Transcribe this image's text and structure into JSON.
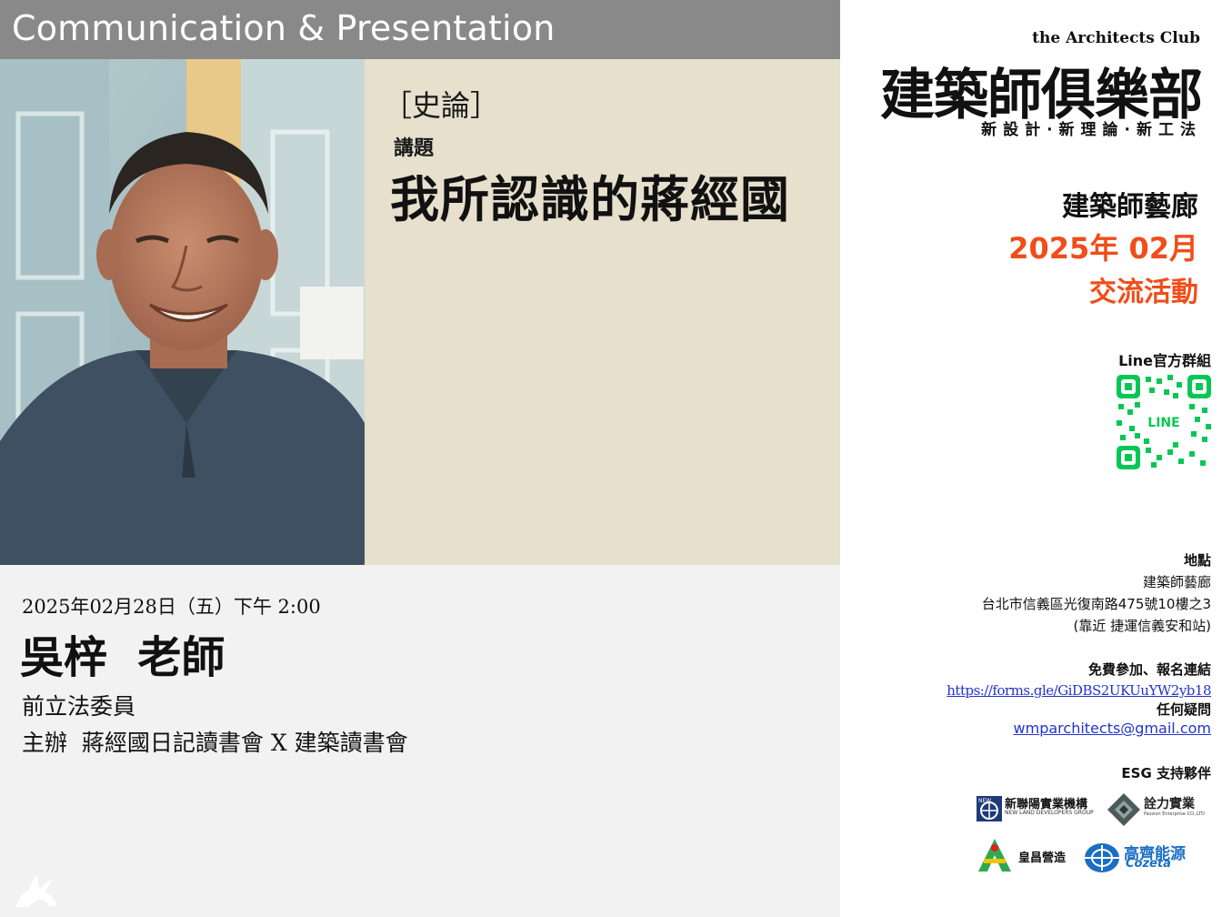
{
  "header": {
    "title": "Communication & Presentation"
  },
  "topic": {
    "category": "［史論］",
    "label": "講題",
    "title": "我所認識的蔣經國"
  },
  "event": {
    "datetime": "2025年02月28日（五）下午  2:00",
    "speaker": "吳梓  老師",
    "role": "前立法委員",
    "host": "主辦  蔣經國日記讀書會 X 建築讀書會"
  },
  "club": {
    "name_en": "the Architects Club",
    "name_zh": "建築師俱樂部",
    "slogan": "新設計·新理論·新工法",
    "gallery": "建築師藝廊",
    "month": "2025年 02月",
    "event_type": "交流活動"
  },
  "line": {
    "label": "Line官方群組",
    "qr_text": "LINE"
  },
  "location": {
    "label": "地點",
    "venue": "建築師藝廊",
    "address": "台北市信義區光復南路475號10樓之3",
    "near": "(靠近 捷運信義安和站)"
  },
  "registration": {
    "label": "免費參加、報名連結",
    "url": "https://forms.gle/GiDBS2UKUuYW2yb18",
    "question_label": "任何疑問",
    "email": "wmparchitects@gmail.com"
  },
  "sponsors": {
    "label": "ESG 支持夥伴",
    "items": [
      {
        "name": "新聯陽實業機構",
        "sub": "NEW LAND DEVELOPERS GROUP",
        "mark": "NEW"
      },
      {
        "name": "詮力實業",
        "sub": "Passion Enterprise CO.,LTD"
      },
      {
        "name": "皇昌營造"
      },
      {
        "name": "高齊能源",
        "sub": "Cozeta"
      }
    ]
  },
  "colors": {
    "accent": "#f04d1a",
    "header_bg": "#898989",
    "topic_bg": "#e6e0cc",
    "info_bg": "#f2f2f2",
    "line_green": "#06c755"
  }
}
